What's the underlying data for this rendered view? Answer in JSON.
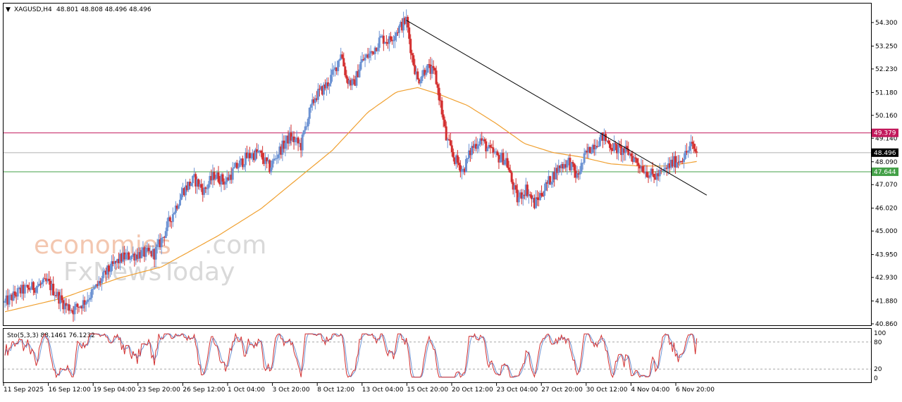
{
  "header": {
    "arrow": "▼",
    "symbol": "XAGUSD,H4",
    "ohlc": "48.801 48.808 48.496 48.496"
  },
  "indicator_label": "Sto(5,3,3) 88.1461 76.1232",
  "watermark": {
    "line1a": "economies",
    "line1b": ".com",
    "line2": "FxNewsToday"
  },
  "colors": {
    "bull": "#6d93d3",
    "bear": "#d32f2f",
    "ma": "#f0a030",
    "trendline": "#000000",
    "resistance": "#c2185b",
    "support": "#43a047",
    "current": "#b0b0b0",
    "stoch_main": "#d32f2f",
    "stoch_signal": "#6d93d3"
  },
  "chart_data": [
    {
      "type": "candlestick",
      "symbol": "XAGUSD",
      "timeframe": "H4",
      "y_ticks": [
        "54.300",
        "53.250",
        "52.230",
        "51.180",
        "50.160",
        "49.140",
        "48.090",
        "47.070",
        "46.020",
        "45.000",
        "43.950",
        "42.930",
        "41.880",
        "40.860"
      ],
      "ylim": [
        40.86,
        54.3
      ],
      "x_ticks": [
        "11 Sep 2025",
        "16 Sep 12:00",
        "19 Sep 04:00",
        "23 Sep 20:00",
        "26 Sep 12:00",
        "1 Oct 04:00",
        "3 Oct 20:00",
        "8 Oct 12:00",
        "13 Oct 04:00",
        "15 Oct 20:00",
        "20 Oct 12:00",
        "23 Oct 04:00",
        "27 Oct 20:00",
        "30 Oct 12:00",
        "4 Nov 04:00",
        "6 Nov 20:00"
      ],
      "price_path": [
        [
          0,
          41.8
        ],
        [
          10,
          42.3
        ],
        [
          20,
          42.5
        ],
        [
          30,
          42.7
        ],
        [
          36,
          42.2
        ],
        [
          42,
          41.7
        ],
        [
          48,
          41.5
        ],
        [
          55,
          41.8
        ],
        [
          62,
          42.3
        ],
        [
          72,
          43.2
        ],
        [
          82,
          43.8
        ],
        [
          95,
          44.0
        ],
        [
          105,
          44.0
        ],
        [
          110,
          44.6
        ],
        [
          118,
          45.8
        ],
        [
          125,
          46.8
        ],
        [
          133,
          47.3
        ],
        [
          140,
          46.8
        ],
        [
          147,
          47.5
        ],
        [
          155,
          47.2
        ],
        [
          162,
          47.8
        ],
        [
          170,
          48.3
        ],
        [
          178,
          48.5
        ],
        [
          186,
          47.8
        ],
        [
          192,
          48.5
        ],
        [
          200,
          49.2
        ],
        [
          208,
          48.8
        ],
        [
          212,
          49.9
        ],
        [
          218,
          51.0
        ],
        [
          226,
          51.5
        ],
        [
          232,
          52.2
        ],
        [
          236,
          53.0
        ],
        [
          240,
          51.8
        ],
        [
          245,
          51.5
        ],
        [
          250,
          52.5
        ],
        [
          258,
          53.0
        ],
        [
          264,
          53.6
        ],
        [
          270,
          53.5
        ],
        [
          276,
          54.0
        ],
        [
          282,
          54.4
        ],
        [
          286,
          52.8
        ],
        [
          290,
          51.7
        ],
        [
          296,
          52.3
        ],
        [
          302,
          52.0
        ],
        [
          306,
          50.7
        ],
        [
          310,
          49.1
        ],
        [
          316,
          48.2
        ],
        [
          322,
          47.7
        ],
        [
          328,
          48.7
        ],
        [
          334,
          49.1
        ],
        [
          340,
          48.6
        ],
        [
          346,
          48.3
        ],
        [
          352,
          48.2
        ],
        [
          356,
          47.2
        ],
        [
          360,
          46.4
        ],
        [
          366,
          46.9
        ],
        [
          372,
          46.2
        ],
        [
          378,
          46.8
        ],
        [
          384,
          47.4
        ],
        [
          390,
          47.9
        ],
        [
          396,
          48.1
        ],
        [
          402,
          47.4
        ],
        [
          408,
          48.4
        ],
        [
          414,
          48.9
        ],
        [
          420,
          49.2
        ],
        [
          426,
          48.8
        ],
        [
          432,
          48.6
        ],
        [
          438,
          48.5
        ],
        [
          444,
          48.1
        ],
        [
          450,
          47.7
        ],
        [
          456,
          47.4
        ],
        [
          462,
          47.6
        ],
        [
          468,
          48.0
        ],
        [
          474,
          48.2
        ],
        [
          478,
          48.4
        ],
        [
          482,
          48.8
        ],
        [
          486,
          48.5
        ]
      ],
      "moving_average": [
        [
          0,
          41.4
        ],
        [
          40,
          42.0
        ],
        [
          80,
          42.9
        ],
        [
          110,
          43.4
        ],
        [
          150,
          44.8
        ],
        [
          180,
          46.0
        ],
        [
          205,
          47.3
        ],
        [
          230,
          48.6
        ],
        [
          255,
          50.3
        ],
        [
          275,
          51.2
        ],
        [
          290,
          51.4
        ],
        [
          305,
          51.1
        ],
        [
          325,
          50.6
        ],
        [
          345,
          49.8
        ],
        [
          365,
          48.9
        ],
        [
          385,
          48.5
        ],
        [
          405,
          48.3
        ],
        [
          425,
          48.0
        ],
        [
          445,
          47.9
        ],
        [
          465,
          47.9
        ],
        [
          486,
          48.1
        ]
      ],
      "trendline": {
        "from": [
          "15 Oct 20:00",
          54.4
        ],
        "to": [
          "6 Nov 20:00",
          46.6
        ]
      },
      "horizontal_levels": [
        {
          "name": "resistance",
          "value": 49.379,
          "label": "49.379"
        },
        {
          "name": "current",
          "value": 48.496,
          "label": "48.496"
        },
        {
          "name": "support",
          "value": 47.644,
          "label": "47.644"
        }
      ]
    },
    {
      "type": "line",
      "indicator": "Sto(5,3,3)",
      "ylim": [
        0,
        100
      ],
      "y_ticks": [
        "100",
        "80",
        "20",
        "0"
      ],
      "levels": [
        80,
        20
      ],
      "latest": {
        "main": 88.1461,
        "signal": 76.1232
      }
    }
  ]
}
